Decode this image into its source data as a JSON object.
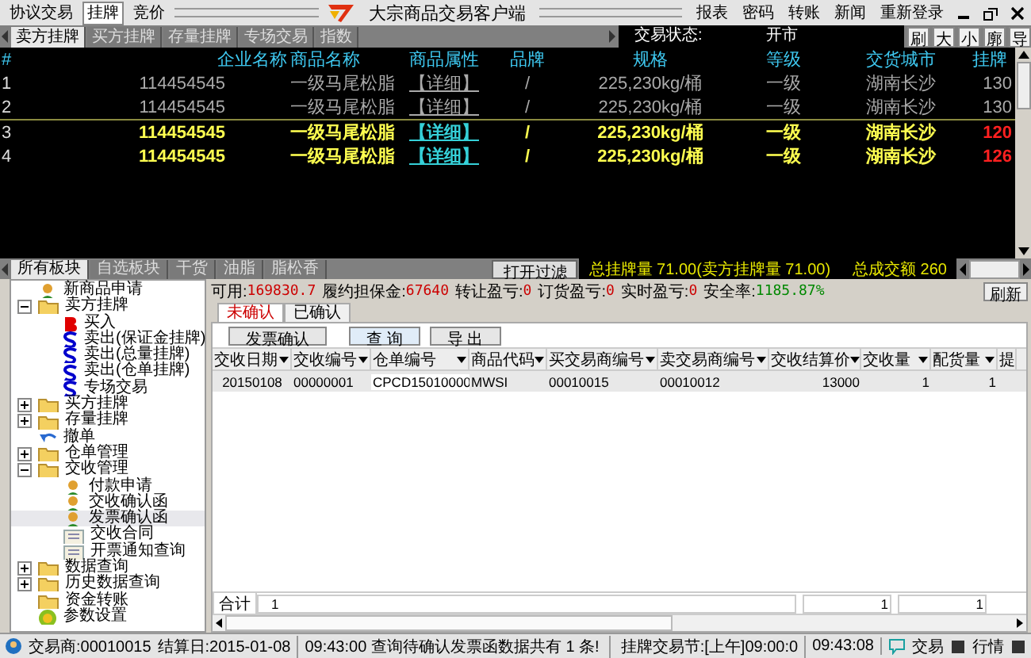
{
  "menu": [
    {
      "label": "协议交易",
      "selected": false
    },
    {
      "label": "挂牌",
      "selected": true
    },
    {
      "label": "竞价",
      "selected": false
    }
  ],
  "title": "大宗商品交易客户端",
  "top_links": [
    "报表",
    "密码",
    "转账",
    "新闻",
    "重新登录"
  ],
  "market_tabs": [
    {
      "label": "卖方挂牌",
      "selected": true
    },
    {
      "label": "买方挂牌",
      "selected": false
    },
    {
      "label": "存量挂牌",
      "selected": false
    },
    {
      "label": "专场交易",
      "selected": false
    },
    {
      "label": "指数",
      "selected": false
    }
  ],
  "trade_status": {
    "label": "交易状态:",
    "value": "开市"
  },
  "view_buttons": [
    "刷",
    "大",
    "小",
    "廓",
    "导"
  ],
  "listing": {
    "columns": [
      "#",
      "企业名称",
      "商品名称",
      "商品属性",
      "品牌",
      "规格",
      "等级",
      "交货城市",
      "挂牌"
    ],
    "rows": [
      {
        "bright": false,
        "cells": [
          "1",
          "114454545",
          "一级马尾松脂",
          "【详细】",
          "/",
          "225,230kg/桶",
          "一级",
          "湖南长沙",
          "130"
        ]
      },
      {
        "bright": false,
        "cells": [
          "2",
          "114454545",
          "一级马尾松脂",
          "【详细】",
          "/",
          "225,230kg/桶",
          "一级",
          "湖南长沙",
          "130"
        ]
      },
      {
        "bright": true,
        "cells": [
          "3",
          "114454545",
          "一级马尾松脂",
          "【详细】",
          "/",
          "225,230kg/桶",
          "一级",
          "湖南长沙",
          "120"
        ]
      },
      {
        "bright": true,
        "cells": [
          "4",
          "114454545",
          "一级马尾松脂",
          "【详细】",
          "/",
          "225,230kg/桶",
          "一级",
          "湖南长沙",
          "126"
        ]
      }
    ]
  },
  "board_tabs": [
    {
      "label": "所有板块",
      "selected": true
    },
    {
      "label": "自选板块",
      "selected": false
    },
    {
      "label": "干货",
      "selected": false
    },
    {
      "label": "油脂",
      "selected": false
    },
    {
      "label": "脂松香",
      "selected": false
    }
  ],
  "filter_button": "打开过滤",
  "totals": [
    "总挂牌量 71.00(卖方挂牌量 71.00)",
    "总成交额 260"
  ],
  "tree": [
    {
      "label": "新商品申请",
      "kind": "person",
      "selected": false
    },
    {
      "label": "卖方挂牌",
      "kind": "folder",
      "expanded": true,
      "selected": false,
      "children": [
        {
          "label": "买入",
          "kind": "buy",
          "selected": false
        },
        {
          "label": "卖出(保证金挂牌)",
          "kind": "sell",
          "selected": false
        },
        {
          "label": "卖出(总量挂牌)",
          "kind": "sell",
          "selected": false
        },
        {
          "label": "卖出(仓单挂牌)",
          "kind": "sell",
          "selected": false
        },
        {
          "label": "专场交易",
          "kind": "sell",
          "selected": false
        }
      ]
    },
    {
      "label": "买方挂牌",
      "kind": "folder",
      "expanded": false,
      "selected": false
    },
    {
      "label": "存量挂牌",
      "kind": "folder",
      "expanded": false,
      "selected": false
    },
    {
      "label": "撤单",
      "kind": "undo",
      "selected": false
    },
    {
      "label": "仓单管理",
      "kind": "folder",
      "expanded": false,
      "selected": false
    },
    {
      "label": "交收管理",
      "kind": "folder",
      "expanded": true,
      "selected": false,
      "children": [
        {
          "label": "付款申请",
          "kind": "person",
          "selected": false
        },
        {
          "label": "交收确认函",
          "kind": "person",
          "selected": false
        },
        {
          "label": "发票确认函",
          "kind": "person",
          "selected": true
        },
        {
          "label": "交收合同",
          "kind": "doc",
          "selected": false
        },
        {
          "label": "开票通知查询",
          "kind": "doc",
          "selected": false
        }
      ]
    },
    {
      "label": "数据查询",
      "kind": "folder",
      "expanded": false,
      "selected": false
    },
    {
      "label": "历史数据查询",
      "kind": "folder",
      "expanded": false,
      "selected": false
    },
    {
      "label": "资金转账",
      "kind": "folder",
      "selected": false
    },
    {
      "label": "参数设置",
      "kind": "gear",
      "selected": false
    }
  ],
  "account": [
    {
      "label": "可用:",
      "value": "169830.7",
      "color": "#cc0000"
    },
    {
      "label": "履约担保金:",
      "value": "67640",
      "color": "#cc0000"
    },
    {
      "label": "转让盈亏:",
      "value": "0",
      "color": "#cc0000"
    },
    {
      "label": "订货盈亏:",
      "value": "0",
      "color": "#cc0000"
    },
    {
      "label": "实时盈亏:",
      "value": "0",
      "color": "#cc0000"
    },
    {
      "label": "安全率:",
      "value": "1185.87%",
      "color": "#008800"
    }
  ],
  "refresh_button": "刷新",
  "sub_tabs": [
    {
      "label": "未确认",
      "selected": true
    },
    {
      "label": "已确认",
      "selected": false
    }
  ],
  "actions": [
    "发票确认",
    "查 询",
    "导 出"
  ],
  "grid": {
    "columns": [
      "交收日期",
      "交收编号",
      "仓单编号",
      "商品代码",
      "买交易商编号",
      "卖交易商编号",
      "交收结算价",
      "交收量",
      "配货量",
      "提"
    ],
    "rows": [
      [
        "20150108",
        "00000001",
        "CPCD15010000",
        "MWSI",
        "00010015",
        "00010012",
        "13000",
        "1",
        "1"
      ]
    ],
    "total": {
      "label": "合计",
      "count": "1",
      "values": [
        "1",
        "1"
      ]
    }
  },
  "status_bar": {
    "trader": "交易商:00010015",
    "settle": "结算日:2015-01-08",
    "message": "09:43:00 查询待确认发票函数据共有 1 条!",
    "session": "挂牌交易节:[上午]09:00:0",
    "clock": "09:43:08",
    "trade": "交易",
    "quote": "行情"
  }
}
